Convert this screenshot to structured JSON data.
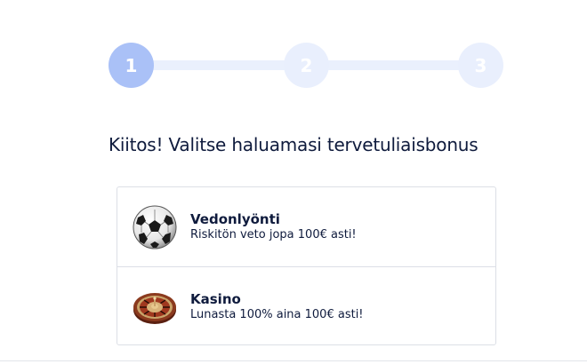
{
  "stepper": {
    "steps": [
      {
        "label": "1",
        "state": "active",
        "color": "#aac1f7"
      },
      {
        "label": "2",
        "state": "inactive",
        "color": "#e9effd"
      },
      {
        "label": "3",
        "state": "inactive",
        "color": "#e9effd"
      }
    ]
  },
  "heading": "Kiitos! Valitse haluamasi tervetuliaisbonus",
  "options": [
    {
      "title": "Vedonlyönti",
      "description": "Riskitön veto jopa 100€ asti!",
      "icon": "soccer-ball-icon"
    },
    {
      "title": "Kasino",
      "description": "Lunasta 100% aina 100€ asti!",
      "icon": "roulette-wheel-icon"
    }
  ],
  "colors": {
    "text": "#0f1b3d",
    "border": "#dcdfe6"
  }
}
